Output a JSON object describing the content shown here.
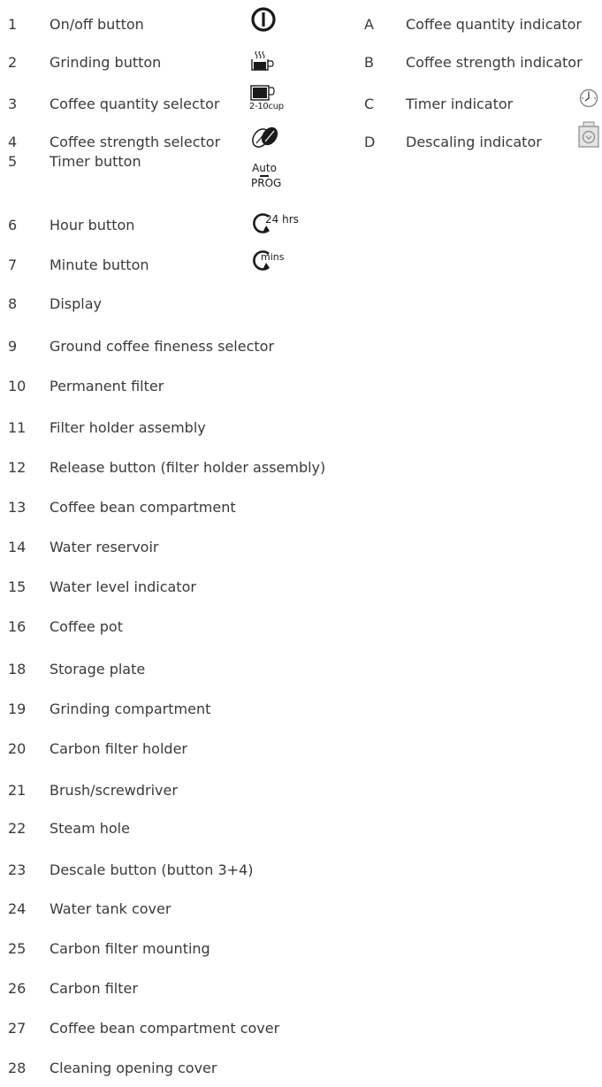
{
  "parts": [
    {
      "num": "1",
      "label": "On/off button",
      "icon": "power-icon"
    },
    {
      "num": "2",
      "label": "Grinding button",
      "icon": "grinding-cup-icon"
    },
    {
      "num": "3",
      "label": "Coffee quantity selector",
      "icon": "cup-quantity-icon",
      "icon_text": "2-10cup"
    },
    {
      "num": "4",
      "label": "Coffee strength selector",
      "icon": "coffee-beans-icon"
    },
    {
      "num": "5",
      "label": "Timer button",
      "icon": "auto-prog-icon",
      "icon_text_top": "Auto",
      "icon_text_bottom": "PROG"
    },
    {
      "num": "6",
      "label": "Hour button",
      "icon": "hour-arrow-icon",
      "icon_text": "24 hrs"
    },
    {
      "num": "7",
      "label": "Minute button",
      "icon": "minute-arrow-icon",
      "icon_text": "mins"
    },
    {
      "num": "8",
      "label": "Display"
    },
    {
      "num": "9",
      "label": "Ground coffee fineness selector"
    },
    {
      "num": "10",
      "label": "Permanent filter"
    },
    {
      "num": "11",
      "label": "Filter holder assembly"
    },
    {
      "num": "12",
      "label": "Release button (filter holder assembly)"
    },
    {
      "num": "13",
      "label": "Coffee bean compartment"
    },
    {
      "num": "14",
      "label": "Water reservoir"
    },
    {
      "num": "15",
      "label": "Water level indicator"
    },
    {
      "num": "16",
      "label": "Coffee pot"
    },
    {
      "num": "18",
      "label": "Storage plate"
    },
    {
      "num": "19",
      "label": "Grinding compartment"
    },
    {
      "num": "20",
      "label": "Carbon filter holder"
    },
    {
      "num": "21",
      "label": "Brush/screwdriver"
    },
    {
      "num": "22",
      "label": "Steam hole"
    },
    {
      "num": "23",
      "label": "Descale button (button 3+4)"
    },
    {
      "num": "24",
      "label": "Water tank cover"
    },
    {
      "num": "25",
      "label": "Carbon filter mounting"
    },
    {
      "num": "26",
      "label": "Carbon filter"
    },
    {
      "num": "27",
      "label": "Coffee bean compartment cover"
    },
    {
      "num": "28",
      "label": "Cleaning opening cover"
    }
  ],
  "indicators": [
    {
      "letter": "A",
      "label": "Coffee quantity indicator"
    },
    {
      "letter": "B",
      "label": "Coffee strength indicator"
    },
    {
      "letter": "C",
      "label": "Timer indicator",
      "icon": "clock-icon"
    },
    {
      "letter": "D",
      "label": "Descaling indicator",
      "icon": "descaling-icon"
    }
  ],
  "colors": {
    "text": "#3a3a3a",
    "icon": "#1a1a1a",
    "indicator_icon": "#888888"
  }
}
